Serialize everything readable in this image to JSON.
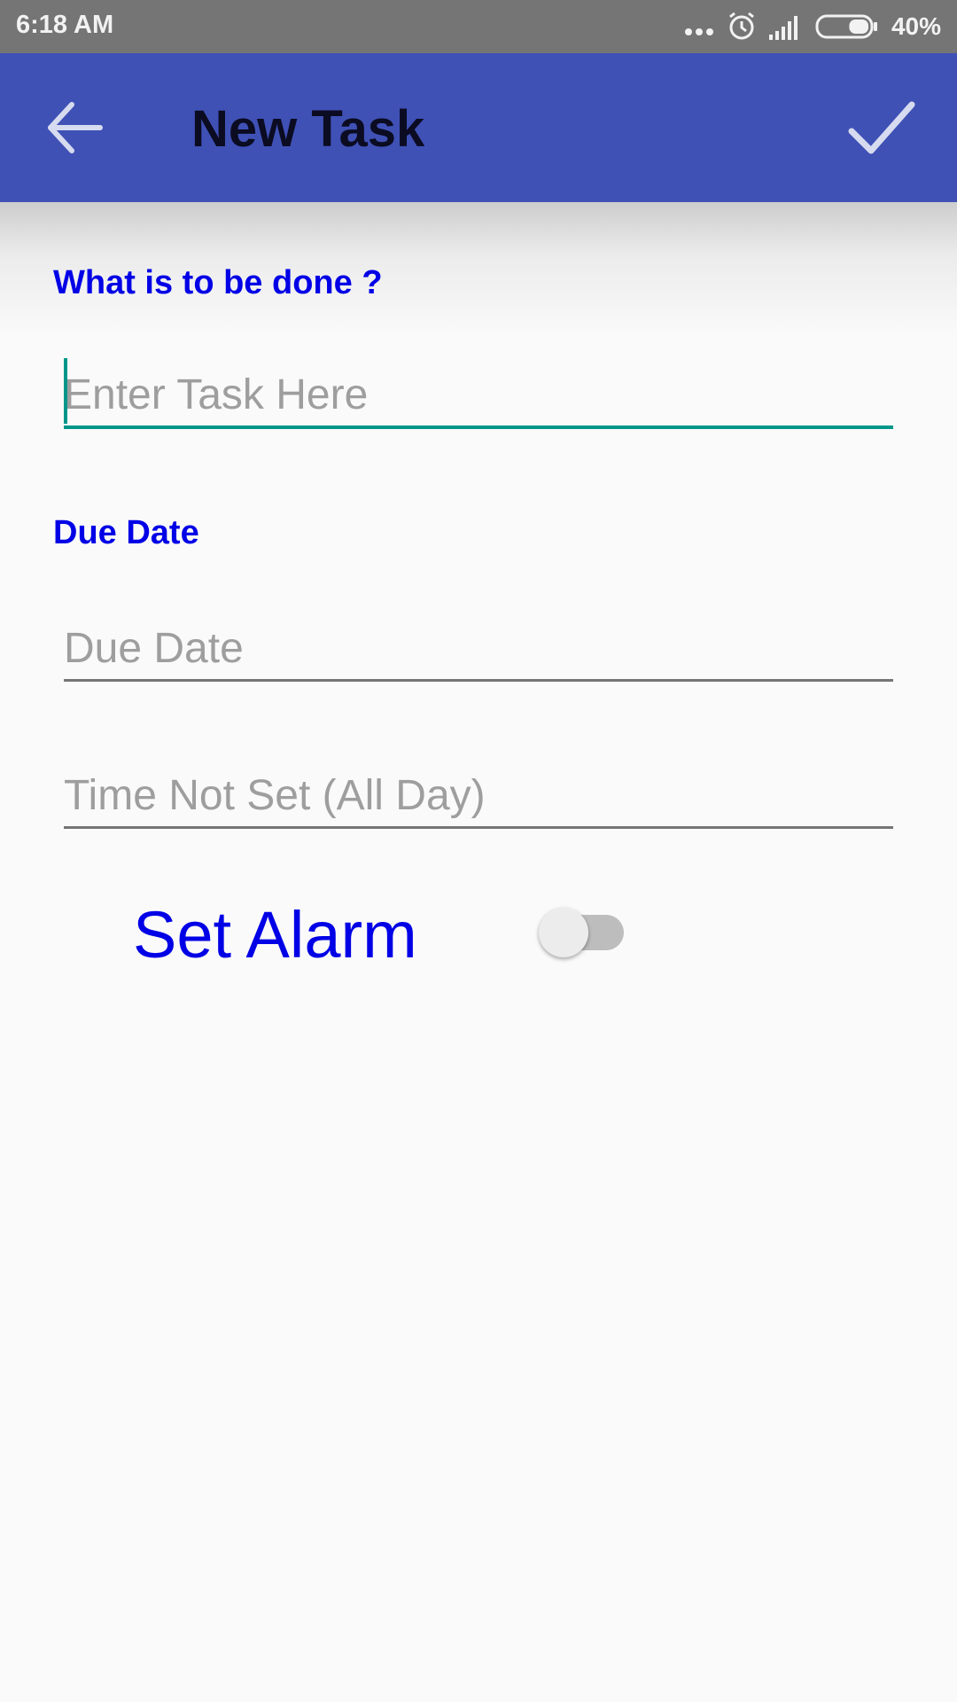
{
  "status_bar": {
    "time": "6:18 AM",
    "battery_percent": "40%",
    "battery_level": 0.4,
    "icons": [
      "more-dots-icon",
      "alarm-clock-icon",
      "signal-bars-icon",
      "battery-icon"
    ]
  },
  "toolbar": {
    "title": "New Task",
    "back_icon": "arrow-left-icon",
    "done_icon": "check-icon"
  },
  "form": {
    "task_label": "What is to be done ?",
    "task_placeholder": "Enter Task Here",
    "task_value": "",
    "due_label": "Due Date",
    "due_placeholder": "Due Date",
    "time_placeholder": "Time Not Set (All Day)",
    "alarm_label": "Set Alarm",
    "alarm_enabled": false
  },
  "colors": {
    "toolbar": "#3f51b5",
    "status_bar": "#757575",
    "label_blue": "#0000e6",
    "accent_teal": "#00968a",
    "background": "#fafafa"
  }
}
